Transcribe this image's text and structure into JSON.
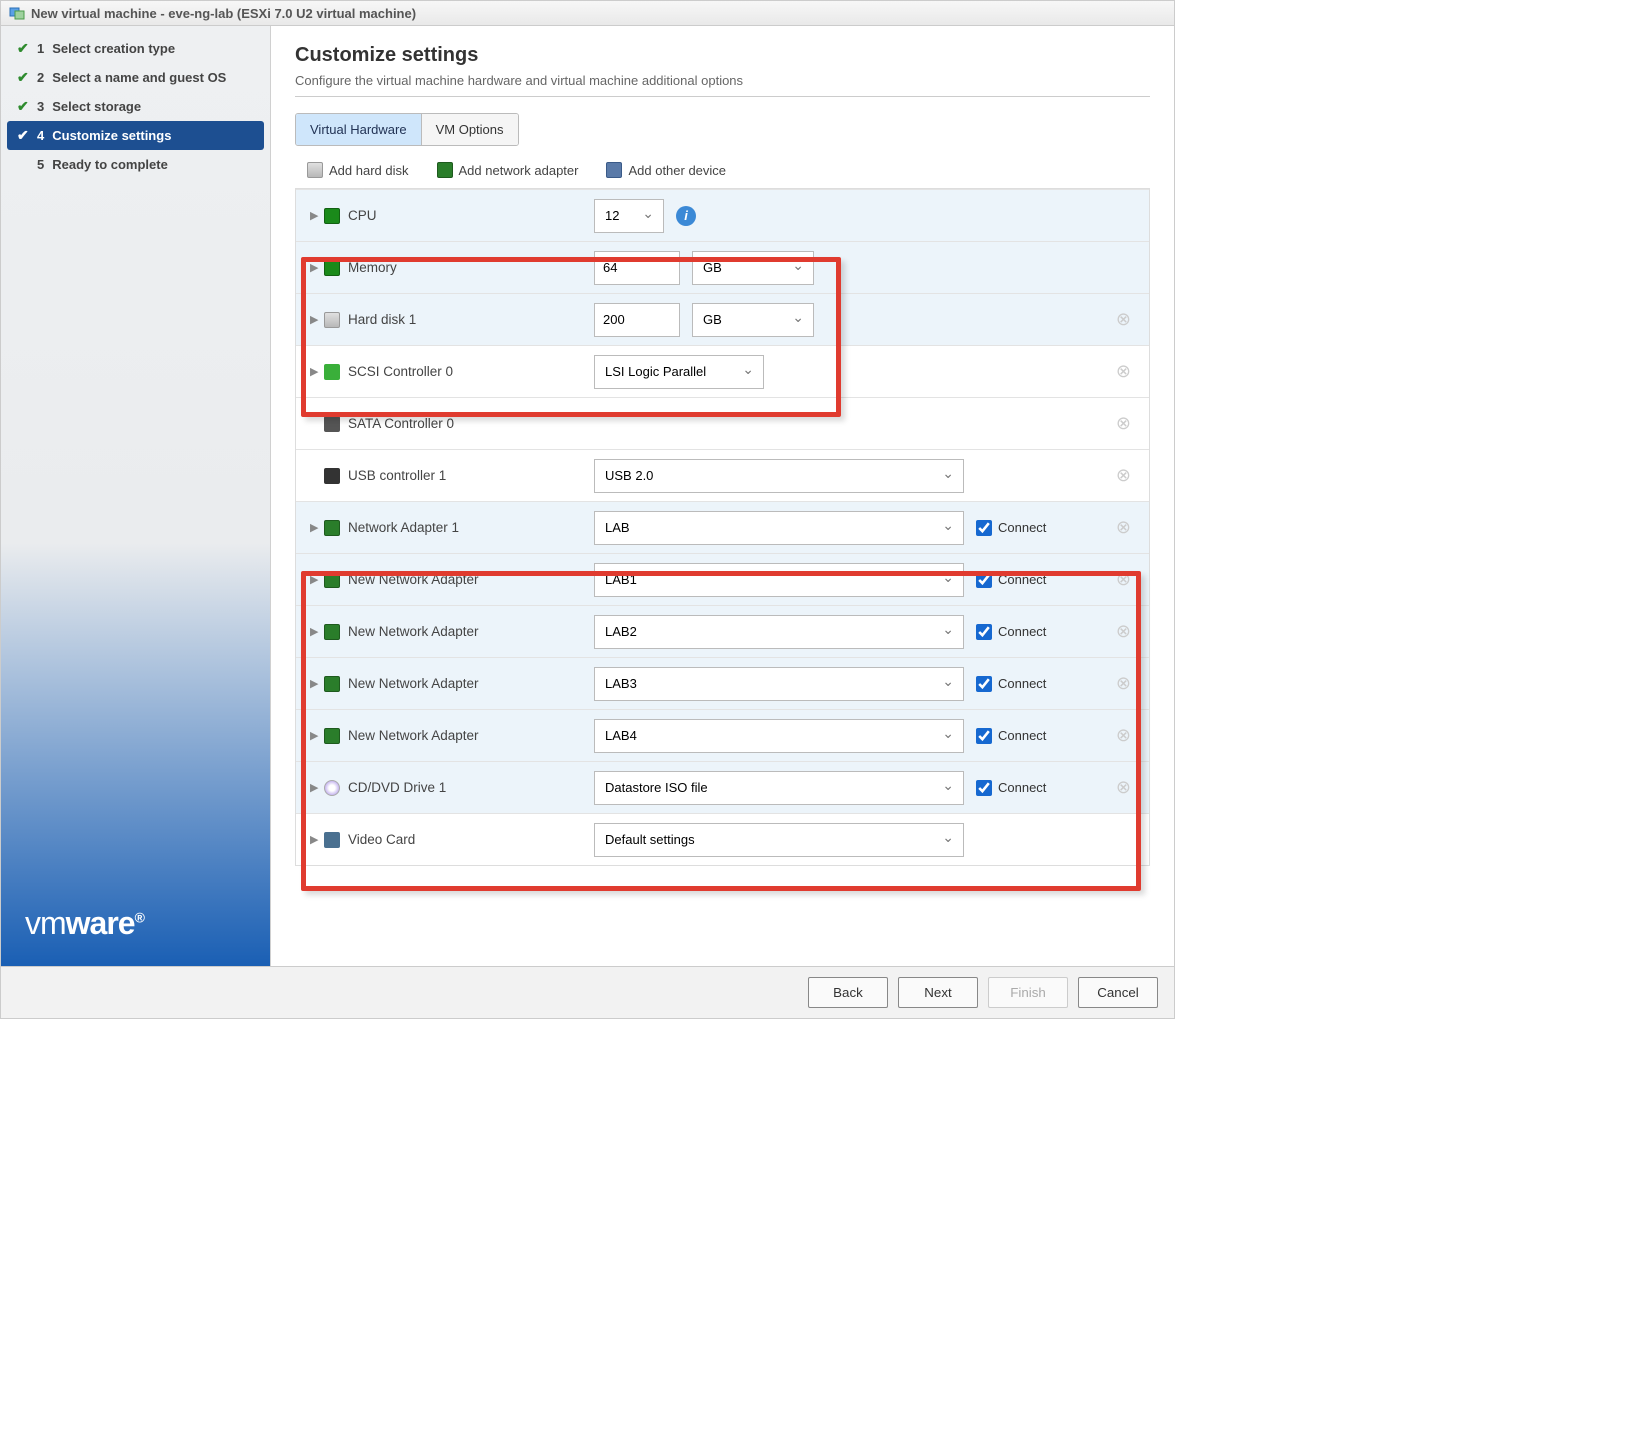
{
  "titlebar": {
    "title": "New virtual machine - eve-ng-lab (ESXi 7.0 U2 virtual machine)"
  },
  "steps": [
    {
      "num": "1",
      "label": "Select creation type",
      "done": true
    },
    {
      "num": "2",
      "label": "Select a name and guest OS",
      "done": true
    },
    {
      "num": "3",
      "label": "Select storage",
      "done": true
    },
    {
      "num": "4",
      "label": "Customize settings",
      "done": true,
      "current": true
    },
    {
      "num": "5",
      "label": "Ready to complete",
      "done": false
    }
  ],
  "logo": "vmware",
  "page": {
    "heading": "Customize settings",
    "subtitle": "Configure the virtual machine hardware and virtual machine additional options"
  },
  "tabs": {
    "hw": "Virtual Hardware",
    "opts": "VM Options"
  },
  "toolbar": {
    "add_disk": "Add hard disk",
    "add_net": "Add network adapter",
    "add_other": "Add other device"
  },
  "rows": {
    "cpu": {
      "label": "CPU",
      "value": "12"
    },
    "memory": {
      "label": "Memory",
      "value": "64",
      "unit": "GB"
    },
    "hdd1": {
      "label": "Hard disk 1",
      "value": "200",
      "unit": "GB"
    },
    "scsi": {
      "label": "SCSI Controller 0",
      "value": "LSI Logic Parallel"
    },
    "sata": {
      "label": "SATA Controller 0"
    },
    "usb": {
      "label": "USB controller 1",
      "value": "USB 2.0"
    },
    "net1": {
      "label": "Network Adapter 1",
      "value": "LAB",
      "connect": "Connect"
    },
    "net2": {
      "label": "New Network Adapter",
      "value": "LAB1",
      "connect": "Connect"
    },
    "net3": {
      "label": "New Network Adapter",
      "value": "LAB2",
      "connect": "Connect"
    },
    "net4": {
      "label": "New Network Adapter",
      "value": "LAB3",
      "connect": "Connect"
    },
    "net5": {
      "label": "New Network Adapter",
      "value": "LAB4",
      "connect": "Connect"
    },
    "cd": {
      "label": "CD/DVD Drive 1",
      "value": "Datastore ISO file",
      "connect": "Connect"
    },
    "video": {
      "label": "Video Card",
      "value": "Default settings"
    }
  },
  "footer": {
    "back": "Back",
    "next": "Next",
    "finish": "Finish",
    "cancel": "Cancel"
  }
}
